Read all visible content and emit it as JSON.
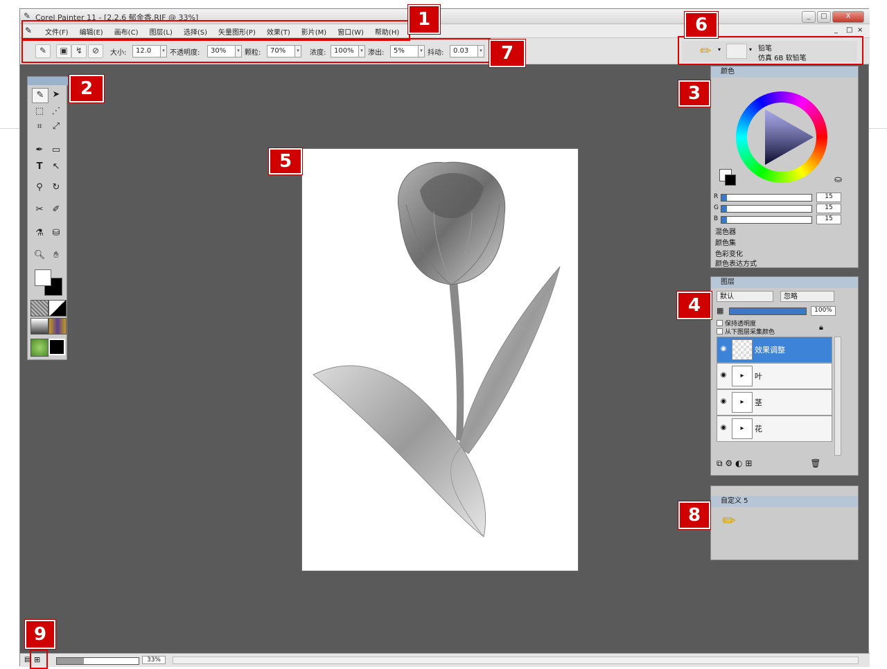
{
  "window": {
    "title": "Corel Painter 11 - [2.2.6 郁金香.RIF @ 33%]",
    "controls": [
      "_",
      "□",
      "X"
    ],
    "doc_controls": [
      "_",
      "□",
      "×"
    ]
  },
  "menu": [
    "文件(F)",
    "编辑(E)",
    "画布(C)",
    "图层(L)",
    "选择(S)",
    "矢量图形(P)",
    "效果(T)",
    "影片(M)",
    "窗口(W)",
    "帮助(H)"
  ],
  "property_bar": {
    "size_label": "大小:",
    "size_value": "12.0",
    "opacity_label": "不透明度:",
    "opacity_value": "30%",
    "grain_label": "颗粒:",
    "grain_value": "70%",
    "resat_label": "浓度:",
    "resat_value": "100%",
    "bleed_label": "渗出:",
    "bleed_value": "5%",
    "jitter_label": "抖动:",
    "jitter_value": "0.03"
  },
  "brush_selector": {
    "category": "铅笔",
    "variant": "仿真 6B 软铅笔"
  },
  "colors_panel": {
    "title": "颜色",
    "rgb": [
      {
        "channel": "R",
        "value": "15",
        "fraction": 0.06
      },
      {
        "channel": "G",
        "value": "15",
        "fraction": 0.06
      },
      {
        "channel": "B",
        "value": "15",
        "fraction": 0.06
      }
    ],
    "sub_panels": [
      "混色器",
      "颜色集",
      "色彩变化",
      "颜色表达方式"
    ]
  },
  "layers_panel": {
    "title": "图层",
    "composite_method": "默认",
    "composite_depth": "忽略",
    "opacity": "100%",
    "opacity_fraction": 1.0,
    "checkbox_preserve": "保持透明度",
    "checkbox_pick": "从下图层采集颜色",
    "layers": [
      {
        "name": "效果调整",
        "selected": true
      },
      {
        "name": "叶",
        "selected": false
      },
      {
        "name": "茎",
        "selected": false
      },
      {
        "name": "花",
        "selected": false
      }
    ]
  },
  "custom_panel": {
    "title": "自定义 5"
  },
  "status_bar": {
    "zoom": "33%"
  },
  "callouts": [
    "1",
    "2",
    "3",
    "4",
    "5",
    "6",
    "7",
    "8",
    "9"
  ],
  "colors": {
    "callout_red": "#d00000",
    "workspace_gray": "#5a5a5a",
    "selected_layer": "#3d84d8"
  }
}
